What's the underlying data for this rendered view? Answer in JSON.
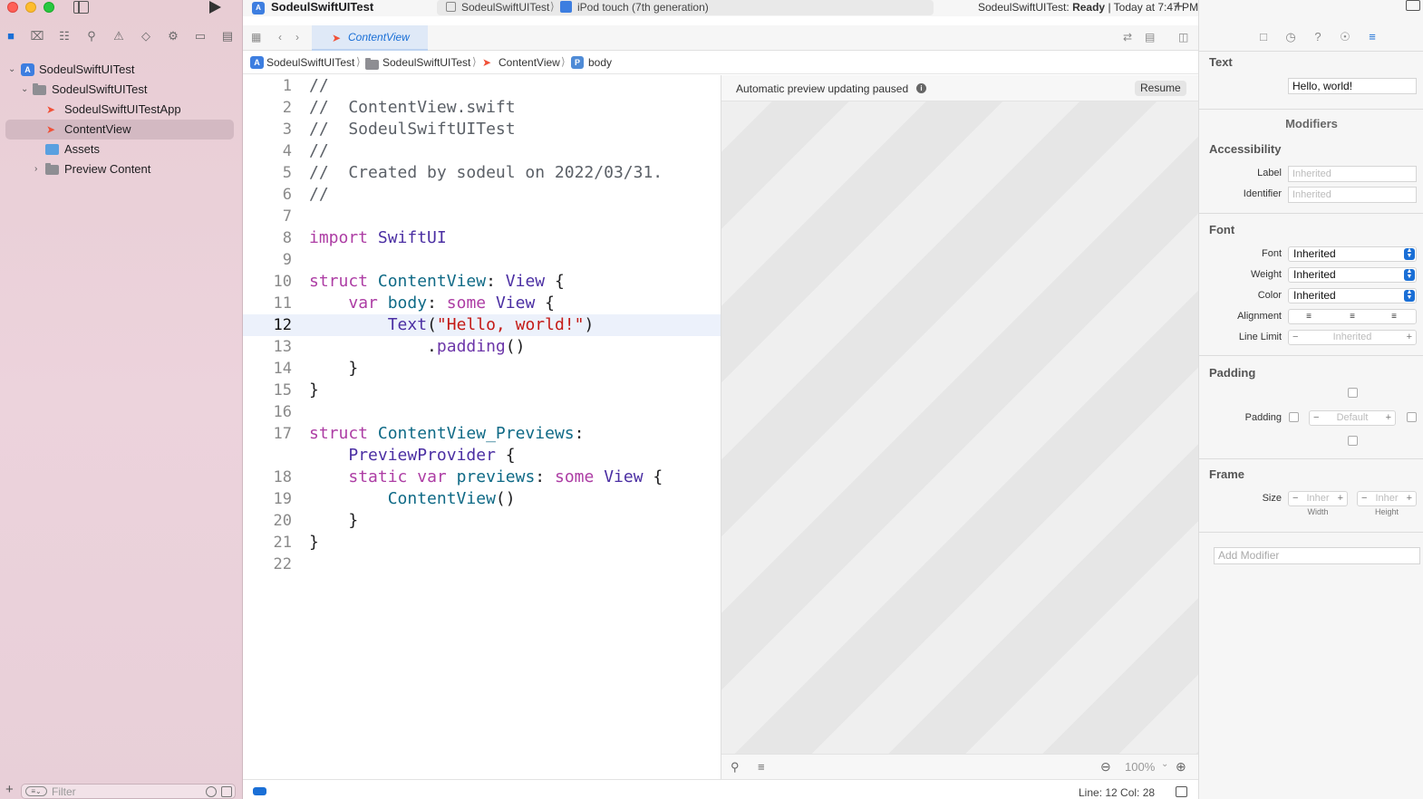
{
  "window": {
    "title": "SodeulSwiftUITest",
    "scheme": "SodeulSwiftUITest",
    "device": "iPod touch (7th generation)",
    "status_app": "SodeulSwiftUITest:",
    "status_state": "Ready",
    "status_time": "| Today at 7:47 PM"
  },
  "navigator": {
    "tree": [
      {
        "label": "SodeulSwiftUITest",
        "kind": "project"
      },
      {
        "label": "SodeulSwiftUITest",
        "kind": "folder"
      },
      {
        "label": "SodeulSwiftUITestApp",
        "kind": "swift"
      },
      {
        "label": "ContentView",
        "kind": "swift",
        "selected": true
      },
      {
        "label": "Assets",
        "kind": "assets"
      },
      {
        "label": "Preview Content",
        "kind": "folder"
      }
    ],
    "filter_placeholder": "Filter"
  },
  "editor": {
    "tab_label": "ContentView",
    "jump_bar": [
      "SodeulSwiftUITest",
      "SodeulSwiftUITest",
      "ContentView",
      "body"
    ],
    "current_line": 12,
    "cursor": "Line: 12  Col: 28",
    "lines": [
      {
        "n": "1",
        "t": "//"
      },
      {
        "n": "2",
        "t": "//  ContentView.swift"
      },
      {
        "n": "3",
        "t": "//  SodeulSwiftUITest"
      },
      {
        "n": "4",
        "t": "//"
      },
      {
        "n": "5",
        "t": "//  Created by sodeul on 2022/03/31."
      },
      {
        "n": "6",
        "t": "//"
      },
      {
        "n": "7",
        "t": ""
      },
      {
        "n": "8",
        "t": "import SwiftUI"
      },
      {
        "n": "9",
        "t": ""
      },
      {
        "n": "10",
        "t": "struct ContentView: View {"
      },
      {
        "n": "11",
        "t": "    var body: some View {"
      },
      {
        "n": "12",
        "t": "        Text(\"Hello, world!\")"
      },
      {
        "n": "13",
        "t": "            .padding()"
      },
      {
        "n": "14",
        "t": "    }"
      },
      {
        "n": "15",
        "t": "}"
      },
      {
        "n": "16",
        "t": ""
      },
      {
        "n": "17",
        "t": "struct ContentView_Previews:"
      },
      {
        "n": "",
        "t": "    PreviewProvider {"
      },
      {
        "n": "18",
        "t": "    static var previews: some View {"
      },
      {
        "n": "19",
        "t": "        ContentView()"
      },
      {
        "n": "20",
        "t": "    }"
      },
      {
        "n": "21",
        "t": "}"
      },
      {
        "n": "22",
        "t": ""
      }
    ]
  },
  "canvas": {
    "message": "Automatic preview updating paused",
    "resume_label": "Resume",
    "zoom": "100%"
  },
  "inspector": {
    "text_section": "Text",
    "text_value": "Hello, world!",
    "modifiers_title": "Modifiers",
    "accessibility": {
      "title": "Accessibility",
      "label_label": "Label",
      "label_placeholder": "Inherited",
      "identifier_label": "Identifier",
      "identifier_placeholder": "Inherited"
    },
    "font": {
      "title": "Font",
      "font_label": "Font",
      "font_value": "Inherited",
      "weight_label": "Weight",
      "weight_value": "Inherited",
      "color_label": "Color",
      "color_value": "Inherited",
      "alignment_label": "Alignment",
      "line_limit_label": "Line Limit",
      "line_limit_value": "Inherited"
    },
    "padding": {
      "title": "Padding",
      "label": "Padding",
      "value": "Default"
    },
    "frame": {
      "title": "Frame",
      "size_label": "Size",
      "width_value": "Inher",
      "height_value": "Inher",
      "width_caption": "Width",
      "height_caption": "Height"
    },
    "add_modifier_placeholder": "Add Modifier"
  }
}
